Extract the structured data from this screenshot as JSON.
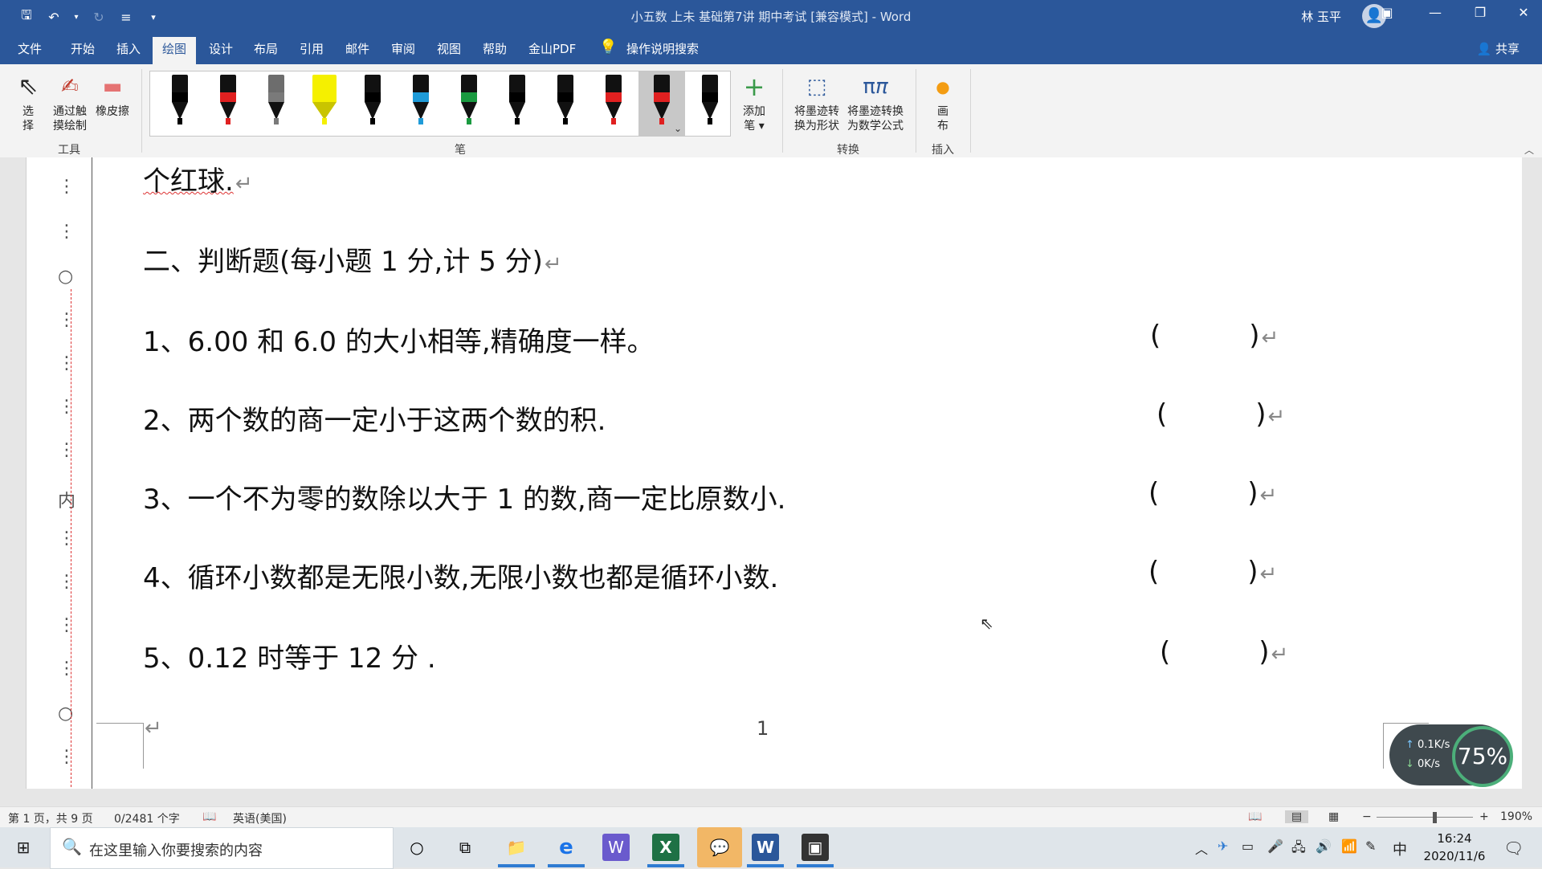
{
  "titlebar": {
    "title": "小五数 上未  基础第7讲 期中考试 [兼容模式]  -  Word",
    "user": "林 玉平",
    "qat_icons": [
      "save-icon",
      "undo-icon",
      "redo-icon",
      "customize-icon"
    ]
  },
  "tabs": [
    "文件",
    "开始",
    "插入",
    "绘图",
    "设计",
    "布局",
    "引用",
    "邮件",
    "审阅",
    "视图",
    "帮助",
    "金山PDF"
  ],
  "active_tab": "绘图",
  "tell_me": "操作说明搜索",
  "share": "共享",
  "ribbon": {
    "tools": {
      "select": "选\n择",
      "touch_draw": "通过触\n摸绘制",
      "eraser": "橡皮擦",
      "group": "工具"
    },
    "pens_group": "笔",
    "pens": [
      {
        "color": "#000000",
        "kind": "pen"
      },
      {
        "color": "#e02020",
        "kind": "pen"
      },
      {
        "color": "#7a7a7a",
        "kind": "pencil"
      },
      {
        "color": "#f5f000",
        "kind": "highlighter"
      },
      {
        "color": "#000000",
        "kind": "pen"
      },
      {
        "color": "#1f9bd8",
        "kind": "pen"
      },
      {
        "color": "#1a9a40",
        "kind": "pen"
      },
      {
        "color": "#000000",
        "kind": "pen"
      },
      {
        "color": "#000000",
        "kind": "pen"
      },
      {
        "color": "#e02020",
        "kind": "pen"
      },
      {
        "color": "#e02020",
        "kind": "pen",
        "selected": true
      },
      {
        "color": "#000000",
        "kind": "pen"
      }
    ],
    "add_pen": "添加\n笔",
    "convert_shape": "将墨迹转\n换为形状",
    "convert_math": "将墨迹转换\n为数学公式",
    "convert_group": "转换",
    "canvas": "画\n布",
    "insert_group": "插入"
  },
  "document": {
    "lines": [
      "个红球.",
      "二、判断题(每小题 1 分,计 5 分)",
      "1、6.00 和 6.0 的大小相等,精确度一样。",
      "2、两个数的商一定小于这两个数的积.",
      "3、一个不为零的数除以大于 1 的数,商一定比原数小.",
      "4、循环小数都是无限小数,无限小数也都是循环小数.",
      "5、0.12 时等于 12 分 ."
    ],
    "paren": "(          )",
    "pilcrow": "↵",
    "page_number": "1",
    "binding_char": "内"
  },
  "net_widget": {
    "up": "0.1K/s",
    "down": "0K/s",
    "percent": "75%"
  },
  "statusbar": {
    "page": "第 1 页，共 9 页",
    "words": "0/2481 个字",
    "language": "英语(美国)",
    "zoom": "190%"
  },
  "taskbar": {
    "search_placeholder": "在这里输入你要搜索的内容",
    "time": "16:24",
    "date": "2020/11/6",
    "ime": "中"
  }
}
